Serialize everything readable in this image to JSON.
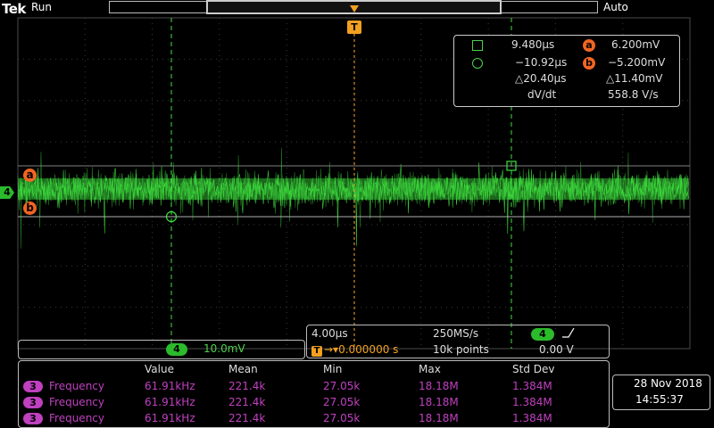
{
  "topbar": {
    "brand": "Tek",
    "run_state": "Run",
    "trigger_mode": "Auto"
  },
  "cursor_readout": {
    "row1": {
      "time": "9.480µs",
      "badge": "a",
      "value": "6.200mV"
    },
    "row2": {
      "time": "−10.92µs",
      "badge": "b",
      "value": "−5.200mV"
    },
    "row3": {
      "delta_time": "△20.40µs",
      "delta_value": "△11.40mV"
    },
    "row4": {
      "label": "dV/dt",
      "value": "558.8 V/s"
    }
  },
  "markers": {
    "cursor_a": "a",
    "cursor_b": "b",
    "channel_ref": "4",
    "trigger": "T"
  },
  "channel_scale": {
    "channel": "4",
    "scale": "10.0mV"
  },
  "horizontal": {
    "timebase": "4.00µs",
    "sample_rate": "250MS/s",
    "trigger_channel": "4",
    "trigger_slope": "⎽⎽/",
    "trigger_position": "0.000000 s",
    "record_length": "10k points",
    "trigger_level": "0.00 V"
  },
  "measurements": {
    "headers": [
      "Value",
      "Mean",
      "Min",
      "Max",
      "Std Dev"
    ],
    "rows": [
      {
        "channel": "3",
        "name": "Frequency",
        "value": "61.91kHz",
        "mean": "221.4k",
        "min": "27.05k",
        "max": "18.18M",
        "std": "1.384M"
      },
      {
        "channel": "3",
        "name": "Frequency",
        "value": "61.91kHz",
        "mean": "221.4k",
        "min": "27.05k",
        "max": "18.18M",
        "std": "1.384M"
      },
      {
        "channel": "3",
        "name": "Frequency",
        "value": "61.91kHz",
        "mean": "221.4k",
        "min": "27.05k",
        "max": "18.18M",
        "std": "1.384M"
      }
    ]
  },
  "datetime": {
    "date": "28 Nov 2018",
    "time": "14:55:37"
  },
  "colors": {
    "trace": "#3ee03e",
    "cursor": "#f26522",
    "trigger": "#f2a020",
    "ch3": "#c040c0",
    "ch4": "#2bbb2b"
  }
}
